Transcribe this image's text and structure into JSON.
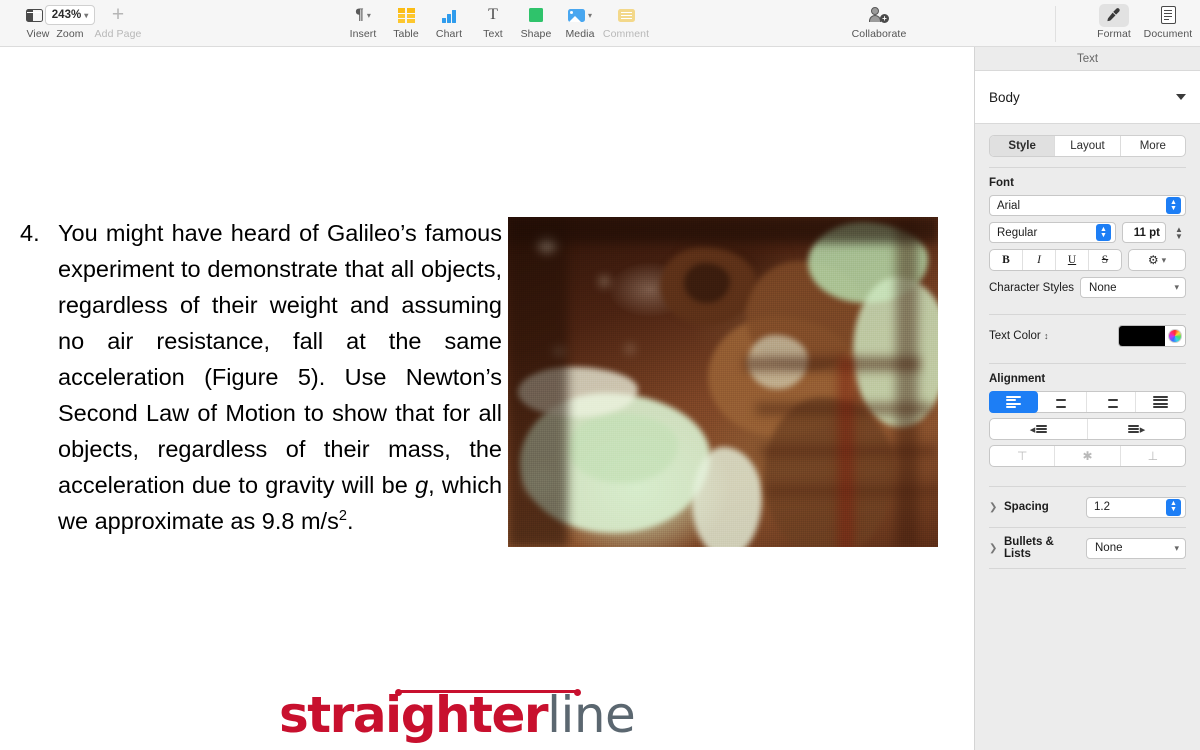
{
  "toolbar": {
    "left": [
      {
        "label": "View",
        "icon": "view-layout-icon",
        "disabled": false
      },
      {
        "label": "Zoom",
        "icon": "zoom-icon",
        "value": "243%",
        "disabled": false
      },
      {
        "label": "Add Page",
        "icon": "plus-icon",
        "disabled": true
      }
    ],
    "center": [
      {
        "label": "Insert",
        "icon": "pilcrow-icon"
      },
      {
        "label": "Table",
        "icon": "table-icon"
      },
      {
        "label": "Chart",
        "icon": "chart-bar-icon"
      },
      {
        "label": "Text",
        "icon": "text-t-icon"
      },
      {
        "label": "Shape",
        "icon": "shape-square-icon"
      },
      {
        "label": "Media",
        "icon": "media-image-icon"
      },
      {
        "label": "Comment",
        "icon": "comment-icon",
        "disabled": true
      }
    ],
    "collaborate": {
      "label": "Collaborate",
      "icon": "collaborate-person-add-icon"
    },
    "right": [
      {
        "label": "Format",
        "icon": "paintbrush-icon",
        "active": true
      },
      {
        "label": "Document",
        "icon": "document-page-icon",
        "active": false
      }
    ]
  },
  "document": {
    "list_number": "4.",
    "paragraph_part1": "You might have heard of Galileo’s famous experiment to demonstrate that all objects, regardless of their weight and assuming no air resistance, fall at the same acceleration (Figure 5). Use Newton’s Second Law of Motion to show that for all objects, regardless of their mass, the acceleration due to gravity will be ",
    "paragraph_italic": "g",
    "paragraph_part2": ", which we approximate as 9.8 m/s",
    "paragraph_sup": "2",
    "paragraph_part3": ".",
    "photo_alt": "apollo-astronaut-photo",
    "logo": {
      "part_bold": "straighter",
      "part_light": "line",
      "color_red": "#c8102e",
      "color_gray": "#5b6770"
    }
  },
  "sidebar": {
    "header": "Text",
    "paragraph_style": "Body",
    "tabs": [
      {
        "label": "Style",
        "active": true
      },
      {
        "label": "Layout",
        "active": false
      },
      {
        "label": "More",
        "active": false
      }
    ],
    "font": {
      "section_label": "Font",
      "family": "Arial",
      "weight": "Regular",
      "size": "11 pt",
      "buttons": [
        {
          "label": "B",
          "name": "bold-button"
        },
        {
          "label": "I",
          "name": "italic-button"
        },
        {
          "label": "U",
          "name": "underline-button"
        },
        {
          "label": "S",
          "name": "strikethrough-button"
        }
      ],
      "options_icon": "gear-icon",
      "character_styles_label": "Character Styles",
      "character_styles_value": "None"
    },
    "text_color": {
      "label": "Text Color",
      "swatch_hex": "#000000",
      "wheel_icon": "color-wheel-icon"
    },
    "alignment": {
      "section_label": "Alignment",
      "buttons": [
        {
          "name": "align-left-button",
          "active": true
        },
        {
          "name": "align-center-button",
          "active": false
        },
        {
          "name": "align-right-button",
          "active": false
        },
        {
          "name": "align-justify-button",
          "active": false
        }
      ],
      "indent_buttons": [
        {
          "name": "decrease-indent-button"
        },
        {
          "name": "increase-indent-button"
        }
      ],
      "vertical_buttons": [
        {
          "name": "align-top-button",
          "disabled": true
        },
        {
          "name": "align-middle-button",
          "disabled": true
        },
        {
          "name": "align-bottom-button",
          "disabled": true
        }
      ]
    },
    "spacing": {
      "label": "Spacing",
      "value": "1.2"
    },
    "bullets": {
      "label": "Bullets & Lists",
      "value": "None"
    },
    "accent_blue": "#1d7ef5"
  }
}
